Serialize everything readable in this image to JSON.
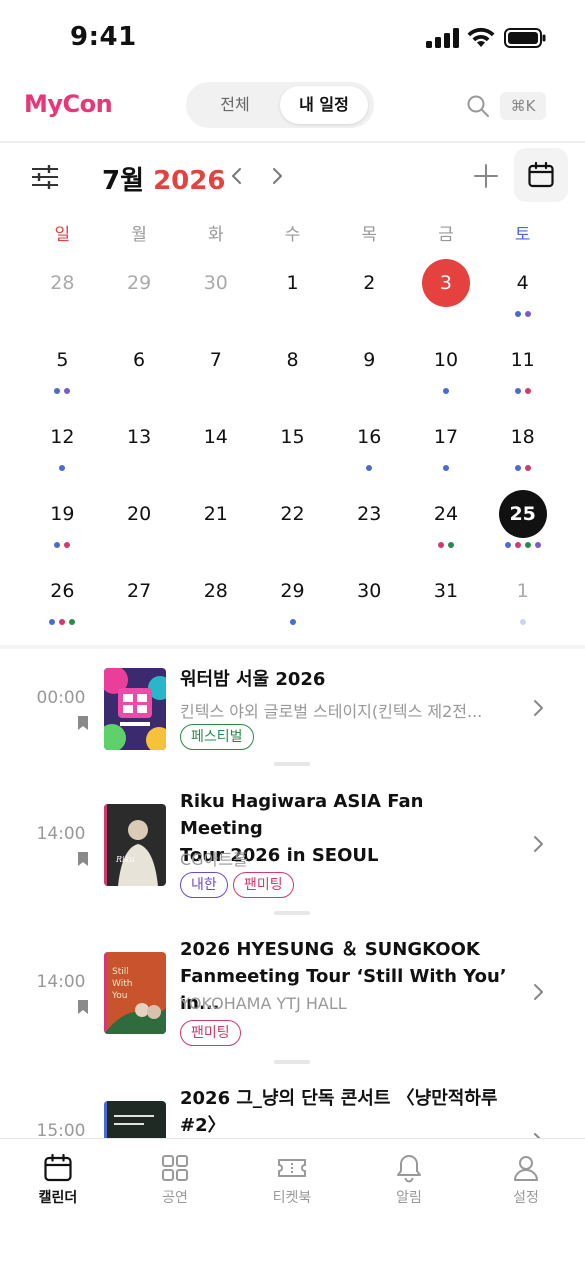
{
  "status_bar": {
    "time": "9:41"
  },
  "header": {
    "logo": "MyCon",
    "tabs": [
      {
        "label": "전체"
      },
      {
        "label": "내 일정"
      }
    ],
    "shortcut": "⌘K"
  },
  "calendar": {
    "month_label": "7월",
    "year_label": "2026",
    "weekdays": [
      "일",
      "월",
      "화",
      "수",
      "목",
      "금",
      "토"
    ],
    "colors": {
      "red": "#e5413f",
      "blue": "#4a6bd0",
      "purple": "#7a5acd",
      "pink": "#d13a6a",
      "green": "#2a8a4a",
      "lightblue": "#c9d6f2"
    },
    "weeks": [
      [
        {
          "d": "28",
          "muted": true,
          "dots": []
        },
        {
          "d": "29",
          "muted": true,
          "dots": []
        },
        {
          "d": "30",
          "muted": true,
          "dots": []
        },
        {
          "d": "1",
          "dots": []
        },
        {
          "d": "2",
          "dots": []
        },
        {
          "d": "3",
          "today": true,
          "dots": []
        },
        {
          "d": "4",
          "dots": [
            "blue",
            "purple"
          ]
        }
      ],
      [
        {
          "d": "5",
          "dots": [
            "blue",
            "purple"
          ]
        },
        {
          "d": "6",
          "dots": []
        },
        {
          "d": "7",
          "dots": []
        },
        {
          "d": "8",
          "dots": []
        },
        {
          "d": "9",
          "dots": []
        },
        {
          "d": "10",
          "dots": [
            "blue"
          ]
        },
        {
          "d": "11",
          "dots": [
            "blue",
            "pink"
          ]
        }
      ],
      [
        {
          "d": "12",
          "dots": [
            "blue"
          ]
        },
        {
          "d": "13",
          "dots": []
        },
        {
          "d": "14",
          "dots": []
        },
        {
          "d": "15",
          "dots": []
        },
        {
          "d": "16",
          "dots": [
            "blue"
          ]
        },
        {
          "d": "17",
          "dots": [
            "blue"
          ]
        },
        {
          "d": "18",
          "dots": [
            "blue",
            "pink"
          ]
        }
      ],
      [
        {
          "d": "19",
          "dots": [
            "blue",
            "pink"
          ]
        },
        {
          "d": "20",
          "dots": []
        },
        {
          "d": "21",
          "dots": []
        },
        {
          "d": "22",
          "dots": []
        },
        {
          "d": "23",
          "dots": []
        },
        {
          "d": "24",
          "dots": [
            "pink",
            "green"
          ]
        },
        {
          "d": "25",
          "selected": true,
          "dots": [
            "blue",
            "pink",
            "green",
            "purple"
          ]
        }
      ],
      [
        {
          "d": "26",
          "dots": [
            "blue",
            "pink",
            "green"
          ]
        },
        {
          "d": "27",
          "dots": []
        },
        {
          "d": "28",
          "dots": []
        },
        {
          "d": "29",
          "dots": [
            "blue"
          ]
        },
        {
          "d": "30",
          "dots": []
        },
        {
          "d": "31",
          "dots": []
        },
        {
          "d": "1",
          "muted": true,
          "dots": [
            "lightblue"
          ]
        }
      ]
    ]
  },
  "events": [
    {
      "time": "00:00",
      "title": "워터밤 서울 2026",
      "venue": "킨텍스 야외 글로벌 스테이지(킨텍스 제2전...",
      "tags": [
        {
          "label": "페스티벌",
          "kind": "fest"
        }
      ]
    },
    {
      "time": "14:00",
      "title": "Riku Hagiwara ASIA Fan Meeting\nTour 2026 in SEOUL",
      "venue": "CG아트홀",
      "tags": [
        {
          "label": "내한",
          "kind": "naehan"
        },
        {
          "label": "팬미팅",
          "kind": "fan"
        }
      ]
    },
    {
      "time": "14:00",
      "title": "2026 HYESUNG ＆ SUNGKOOK\nFanmeeting Tour ‘Still With You’ in...",
      "venue": "YOKOHAMA YTJ HALL",
      "tags": [
        {
          "label": "팬미팅",
          "kind": "fan"
        }
      ]
    },
    {
      "time": "15:00",
      "title": "2026 그_냥의 단독 콘서트 〈냥만적하루\n#2〉",
      "venue": "",
      "tags": []
    }
  ],
  "bottom_nav": [
    {
      "label": "캘린더",
      "icon": "calendar-icon",
      "active": true
    },
    {
      "label": "공연",
      "icon": "grid-icon"
    },
    {
      "label": "티켓북",
      "icon": "ticket-icon"
    },
    {
      "label": "알림",
      "icon": "bell-icon"
    },
    {
      "label": "설정",
      "icon": "user-icon"
    }
  ]
}
